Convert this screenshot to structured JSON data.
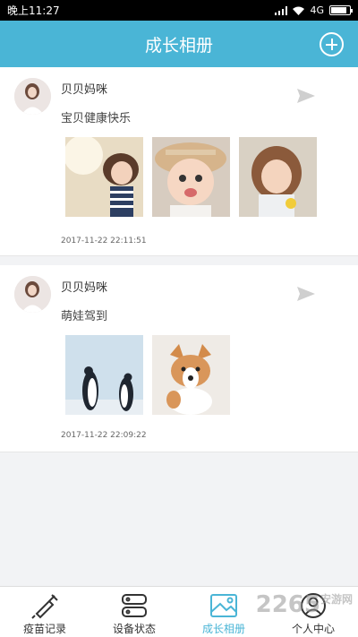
{
  "status_bar": {
    "time": "晚上11:27",
    "network": "4G",
    "battery_level": 0.85
  },
  "header": {
    "title": "成长相册",
    "add_icon": "plus-circle-icon"
  },
  "posts": [
    {
      "username": "贝贝妈咪",
      "caption": "宝贝健康快乐",
      "timestamp": "2017-11-22 22:11:51",
      "photos": [
        "girl-in-sunlight-photo",
        "girl-in-straw-hat-photo",
        "girl-with-flower-photo"
      ]
    },
    {
      "username": "贝贝妈咪",
      "caption": "萌娃驾到",
      "timestamp": "2017-11-22 22:09:22",
      "photos": [
        "penguins-photo",
        "corgi-puppy-photo"
      ]
    }
  ],
  "tabbar": {
    "tabs": [
      {
        "label": "疫苗记录",
        "icon": "syringe-icon",
        "active": false
      },
      {
        "label": "设备状态",
        "icon": "device-icon",
        "active": false
      },
      {
        "label": "成长相册",
        "icon": "album-icon",
        "active": true
      },
      {
        "label": "个人中心",
        "icon": "user-icon",
        "active": false
      }
    ]
  },
  "watermark": {
    "text": "2265",
    "sub": "安游网"
  },
  "colors": {
    "accent": "#4ab5d6",
    "background": "#f2f3f5"
  }
}
